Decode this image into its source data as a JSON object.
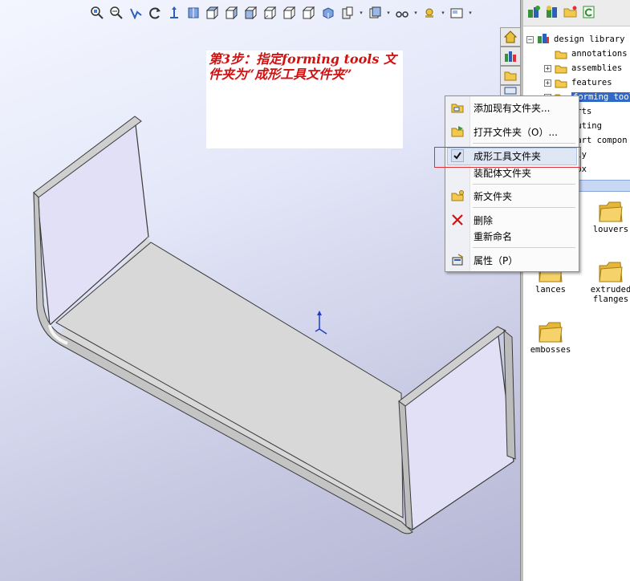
{
  "note": {
    "text": "第3步：指定forming tools 文件夹为“成形工具文件夹”",
    "color": "#d11010"
  },
  "hud_toolbar": {
    "icons": [
      "zoom-to-fit-icon",
      "zoom-to-area-icon",
      "previous-view-icon",
      "rotate-view-icon",
      "pan-icon",
      "section-view-icon",
      "front-view-icon",
      "back-view-icon",
      "top-view-icon",
      "bottom-view-icon",
      "right-view-icon",
      "isometric-view-icon",
      "display-style-icon",
      "hide-show-items-icon",
      "edit-appearance-icon",
      "apply-scene-icon",
      "view-settings-icon"
    ]
  },
  "task_pane": {
    "toolbar_icons": [
      "add-to-library-icon",
      "add-file-location-icon",
      "create-folder-icon",
      "refresh-icon"
    ],
    "side_tabs": [
      "home-tab-icon",
      "design-library-tab-icon",
      "file-explorer-tab-icon",
      "view-palette-tab-icon"
    ],
    "tree": {
      "root": "design library",
      "items": [
        {
          "label": "annotations",
          "expandable": false
        },
        {
          "label": "assemblies",
          "expandable": true
        },
        {
          "label": "features",
          "expandable": true
        },
        {
          "label": "forming tool",
          "expandable": true,
          "selected": true
        },
        {
          "label": "arts",
          "expandable": false
        },
        {
          "label": "outing",
          "expandable": false
        },
        {
          "label": "nart compon",
          "expandable": false
        },
        {
          "label": "mly",
          "expandable": false
        },
        {
          "label": "box",
          "expandable": false
        }
      ]
    },
    "folders": [
      {
        "label": "louvers"
      },
      {
        "label": "lances"
      },
      {
        "label": "extruded flanges"
      },
      {
        "label": "embosses"
      }
    ]
  },
  "context_menu": {
    "items": [
      {
        "label": "添加现有文件夹...",
        "icon": "add-folder-icon"
      },
      {
        "label": "打开文件夹（O）...",
        "icon": "open-folder-icon"
      },
      {
        "label": "成形工具文件夹",
        "icon": "checkmark-icon",
        "checked": true,
        "highlighted": true
      },
      {
        "label": "装配体文件夹",
        "icon": ""
      },
      {
        "label": "新文件夹",
        "icon": "new-folder-icon"
      },
      {
        "label": "删除",
        "icon": "delete-icon"
      },
      {
        "label": "重新命名",
        "icon": ""
      },
      {
        "label": "属性（P）",
        "icon": "properties-icon"
      }
    ],
    "highlight_color": "#dfe6f4",
    "marker_color": "#e0303a"
  },
  "colors": {
    "selection": "#3169c6",
    "folder": "#f2c94c",
    "model_face": "#d6d6d6",
    "model_inner": "#e0dff6"
  }
}
